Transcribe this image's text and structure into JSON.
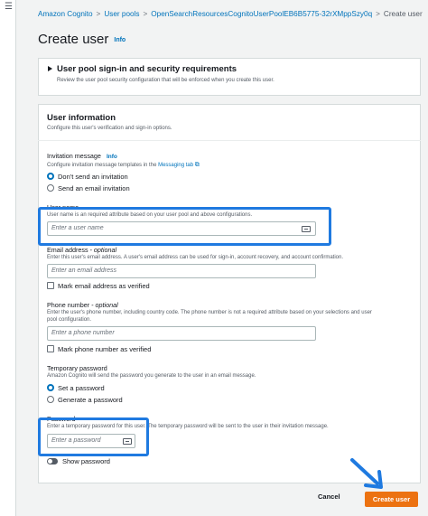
{
  "breadcrumb": {
    "items": [
      "Amazon Cognito",
      "User pools",
      "OpenSearchResourcesCognitoUserPoolEB6B5775-32rXMppSzy0q"
    ],
    "separator": ">",
    "current": "Create user"
  },
  "page": {
    "title": "Create user",
    "info": "Info"
  },
  "signin_panel": {
    "title": "User pool sign-in and security requirements",
    "description": "Review the user pool security configuration that will be enforced when you create this user."
  },
  "user_info": {
    "title": "User information",
    "description": "Configure this user's verification and sign-in options.",
    "invitation": {
      "label": "Invitation message",
      "info": "Info",
      "description": "Configure invitation message templates in the",
      "link": "Messaging tab",
      "options": [
        "Don't send an invitation",
        "Send an email invitation"
      ],
      "selected": 0
    },
    "username": {
      "label": "User name",
      "description": "User name is an required attribute based on your user pool and above configurations.",
      "placeholder": "Enter a user name"
    },
    "email": {
      "label": "Email address",
      "optional": "- optional",
      "description": "Enter this user's email address. A user's email address can be used for sign-in, account recovery, and account confirmation.",
      "placeholder": "Enter an email address",
      "verify_label": "Mark email address as verified"
    },
    "phone": {
      "label": "Phone number",
      "optional": "- optional",
      "description_line1": "Enter the user's phone number, including country code. The phone number is not a required attribute based on your selections and user",
      "description_line2": "pool configuration.",
      "placeholder": "Enter a phone number",
      "verify_label": "Mark phone number as verified"
    },
    "temp_password": {
      "label": "Temporary password",
      "description": "Amazon Cognito will send the password you generate to the user in an email message.",
      "options": [
        "Set a password",
        "Generate a password"
      ],
      "selected": 0
    },
    "password": {
      "label": "Password",
      "description": "Enter a temporary password for this user. The temporary password will be sent to the user in their invitation message.",
      "placeholder": "Enter a password",
      "show_label": "Show password"
    }
  },
  "footer": {
    "cancel": "Cancel",
    "create": "Create user"
  },
  "colors": {
    "accent": "#0073bb",
    "primary_button": "#ec7211",
    "highlight": "#1f7ae0"
  }
}
